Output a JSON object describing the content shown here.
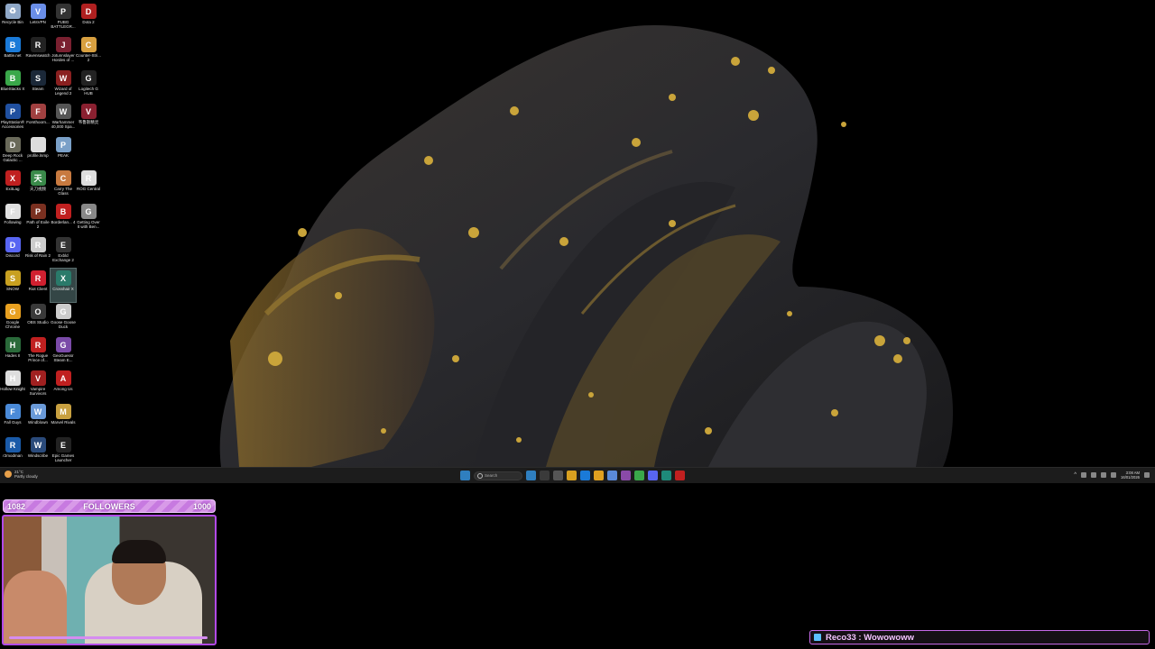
{
  "desktop_icons": [
    {
      "label": "Recycle Bin",
      "color": "#8fa8c8",
      "glyph": "♻"
    },
    {
      "label": "LetsVPN",
      "color": "#6a8ee8",
      "glyph": "V"
    },
    {
      "label": "PUBG BATTLEGR...",
      "color": "#333333",
      "glyph": "P"
    },
    {
      "label": "Dota 2",
      "color": "#b02020",
      "glyph": "D"
    },
    {
      "label": "Battle.net",
      "color": "#1a7ad8",
      "glyph": "B"
    },
    {
      "label": "Ravenswatch",
      "color": "#222222",
      "glyph": "R"
    },
    {
      "label": "Jotunnslayer Hordes of ...",
      "color": "#7a2030",
      "glyph": "J"
    },
    {
      "label": "Counter-Stri... 2",
      "color": "#d8a040",
      "glyph": "C"
    },
    {
      "label": "BlueStacks X",
      "color": "#3aa84a",
      "glyph": "B"
    },
    {
      "label": "Steam",
      "color": "#1b2838",
      "glyph": "S"
    },
    {
      "label": "Wizard of Legend 2",
      "color": "#8a2020",
      "glyph": "W"
    },
    {
      "label": "Logitech G HUB",
      "color": "#222222",
      "glyph": "G"
    },
    {
      "label": "PlayStation® Accessories",
      "color": "#2050a0",
      "glyph": "P"
    },
    {
      "label": "Forsthoorn...",
      "color": "#a04040",
      "glyph": "F"
    },
    {
      "label": "Warhammer 40,000 Spa...",
      "color": "#555555",
      "glyph": "W"
    },
    {
      "label": "韦鲁斯精灵",
      "color": "#8a2030",
      "glyph": "V"
    },
    {
      "label": "Deep Rock Galactic ...",
      "color": "#6a6a5a",
      "glyph": "D"
    },
    {
      "label": "profile.lnmp",
      "color": "#dddddd",
      "glyph": ""
    },
    {
      "label": "PEAK",
      "color": "#7aa0c8",
      "glyph": "P"
    },
    {
      "label": "",
      "color": "transparent",
      "glyph": ""
    },
    {
      "label": "ExitLag",
      "color": "#c02020",
      "glyph": "X"
    },
    {
      "label": "天刀视频",
      "color": "#3a8a4a",
      "glyph": "天"
    },
    {
      "label": "Carry The Glass",
      "color": "#c87a40",
      "glyph": "C"
    },
    {
      "label": "ROG Central",
      "color": "#dddddd",
      "glyph": "R"
    },
    {
      "label": "Following",
      "color": "#e0e0e0",
      "glyph": "F"
    },
    {
      "label": "Path of Exile 2",
      "color": "#7a3020",
      "glyph": "P"
    },
    {
      "label": "Borderlan... 4",
      "color": "#c02020",
      "glyph": "B"
    },
    {
      "label": "Getting Over It with Ben...",
      "color": "#888888",
      "glyph": "G"
    },
    {
      "label": "Discord",
      "color": "#5865f2",
      "glyph": "D"
    },
    {
      "label": "Risk of Rain 2",
      "color": "#cccccc",
      "glyph": "R"
    },
    {
      "label": "Exbld Exchange 2",
      "color": "#333333",
      "glyph": "E"
    },
    {
      "label": "",
      "color": "transparent",
      "glyph": ""
    },
    {
      "label": "SNOW",
      "color": "#c8a020",
      "glyph": "S"
    },
    {
      "label": "Riot Client",
      "color": "#d02030",
      "glyph": "R"
    },
    {
      "label": "Crosshair X",
      "color": "#2a7a6a",
      "glyph": "X"
    },
    {
      "label": "",
      "color": "transparent",
      "glyph": ""
    },
    {
      "label": "Google Chrome",
      "color": "#e8a020",
      "glyph": "G"
    },
    {
      "label": "OBS Studio",
      "color": "#3a3a3a",
      "glyph": "O"
    },
    {
      "label": "Goose Goose Duck",
      "color": "#cccccc",
      "glyph": "G"
    },
    {
      "label": "",
      "color": "transparent",
      "glyph": ""
    },
    {
      "label": "Hades II",
      "color": "#2a6a3a",
      "glyph": "H"
    },
    {
      "label": "The Rogue Prince of...",
      "color": "#c02020",
      "glyph": "R"
    },
    {
      "label": "GeoGuessr Steam E...",
      "color": "#7a4aa8",
      "glyph": "G"
    },
    {
      "label": "",
      "color": "transparent",
      "glyph": ""
    },
    {
      "label": "Hollow Knight",
      "color": "#dddddd",
      "glyph": "H"
    },
    {
      "label": "Vampire Survivors",
      "color": "#a02020",
      "glyph": "V"
    },
    {
      "label": "Among Us",
      "color": "#c02020",
      "glyph": "A"
    },
    {
      "label": "",
      "color": "transparent",
      "glyph": ""
    },
    {
      "label": "Fall Guys",
      "color": "#4a8ad8",
      "glyph": "F"
    },
    {
      "label": "Windblown",
      "color": "#6a9ad8",
      "glyph": "W"
    },
    {
      "label": "Marvel Rivals",
      "color": "#c8a040",
      "glyph": "M"
    },
    {
      "label": "",
      "color": "transparent",
      "glyph": ""
    },
    {
      "label": "r2modman",
      "color": "#1a5aa8",
      "glyph": "R"
    },
    {
      "label": "Windscribe",
      "color": "#2a4a7a",
      "glyph": "W"
    },
    {
      "label": "Epic Games Launcher",
      "color": "#222222",
      "glyph": "E"
    },
    {
      "label": "",
      "color": "transparent",
      "glyph": ""
    }
  ],
  "selected_icon": "Crosshair X",
  "taskbar": {
    "weather_temp": "21°C",
    "weather_desc": "Partly cloudy",
    "search_placeholder": "Search",
    "apps": [
      "#2f7fbf",
      "#3a3a3a",
      "#555555",
      "#d8a020",
      "#1a7ad8",
      "#e0a020",
      "#5a8ad8",
      "#8a4aa8",
      "#3aa84a",
      "#5865f2",
      "#1e8a7a",
      "#c02020"
    ],
    "time": "3:08 AM",
    "date": "16/01/2026"
  },
  "overlay": {
    "followers_current": "1082",
    "followers_label": "FOLLOWERS",
    "followers_goal": "1000",
    "chat_user": "Reco33",
    "chat_text": "Reco33 : Wowowoww"
  },
  "colors": {
    "accent": "#b24ae8",
    "chat_text": "#f3c4ff",
    "wallpaper_gold": "#c9a43a"
  }
}
